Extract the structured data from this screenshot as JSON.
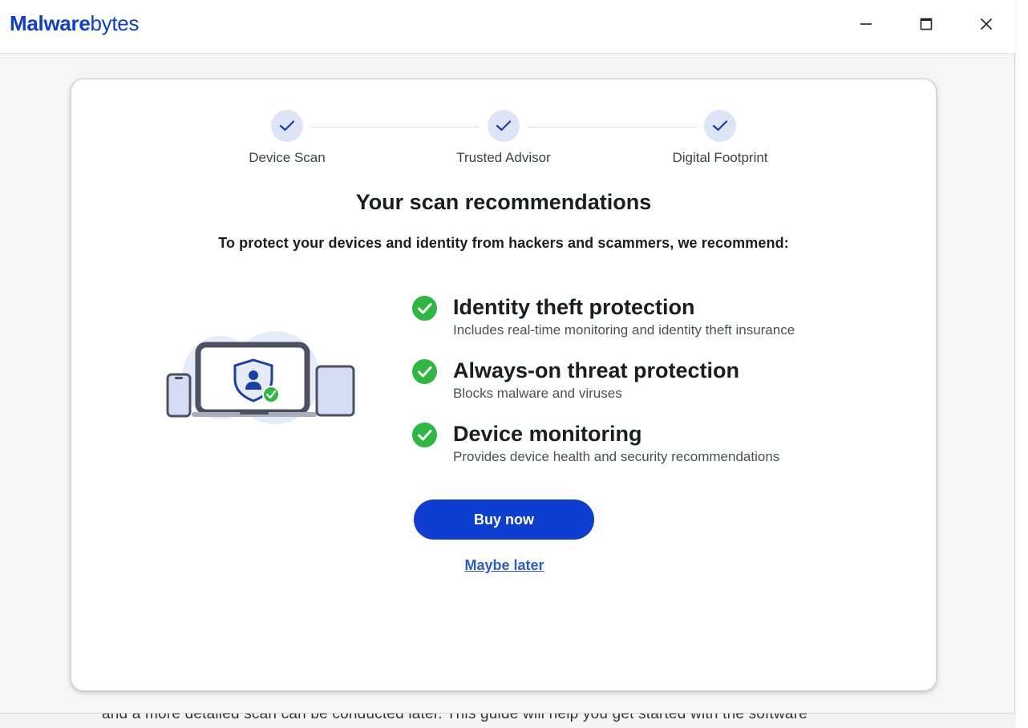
{
  "brand": {
    "logo_strong": "Malware",
    "logo_light": "bytes",
    "color": "#0d3ecf"
  },
  "window_controls": {
    "minimize_icon": "minimize-icon",
    "maximize_icon": "maximize-icon",
    "close_icon": "close-icon"
  },
  "steps": [
    {
      "label": "Device Scan",
      "status": "complete",
      "icon": "check-icon"
    },
    {
      "label": "Trusted Advisor",
      "status": "complete",
      "icon": "check-icon"
    },
    {
      "label": "Digital Footprint",
      "status": "complete",
      "icon": "check-icon"
    }
  ],
  "recommendations": {
    "title": "Your scan recommendations",
    "subtitle": "To protect your devices and identity from hackers and scammers, we recommend:",
    "features": [
      {
        "title": "Identity theft protection",
        "description": "Includes real-time monitoring and identity theft insurance",
        "icon": "green-check-circle-icon"
      },
      {
        "title": "Always-on threat protection",
        "description": "Blocks malware and viruses",
        "icon": "green-check-circle-icon"
      },
      {
        "title": "Device monitoring",
        "description": "Provides device health and security recommendations",
        "icon": "green-check-circle-icon"
      }
    ],
    "illustration": "devices-shield-illustration"
  },
  "actions": {
    "buy_label": "Buy now",
    "later_label": "Maybe later"
  },
  "background_page": {
    "text": "and a more detailed scan can be conducted later. This guide will help you get started with the software"
  },
  "colors": {
    "accent": "#0d3ecf",
    "success": "#2fb841",
    "step_circle": "#dde4f6",
    "link": "#2e5ad6"
  }
}
